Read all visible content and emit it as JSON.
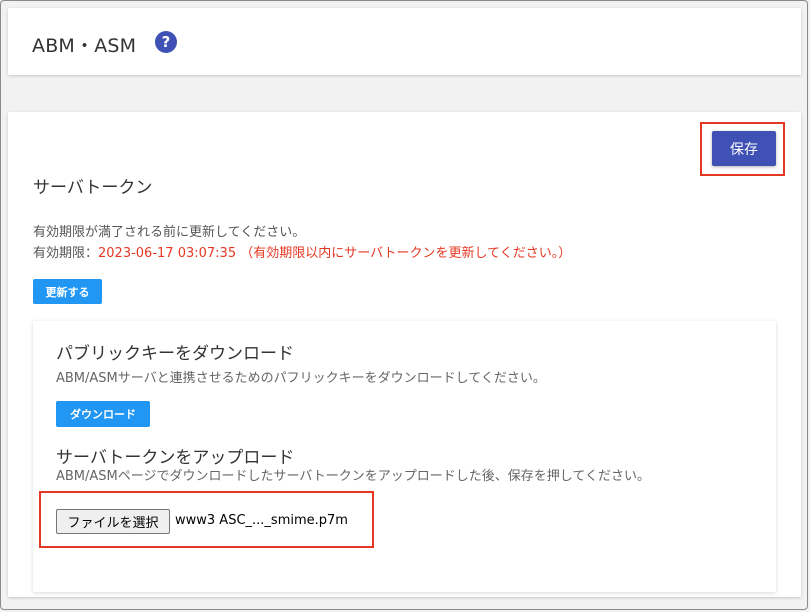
{
  "header": {
    "title": "ABM・ASM",
    "help_icon": "question-icon",
    "help_glyph": "?"
  },
  "toolbar": {
    "save_label": "保存"
  },
  "server_token": {
    "title": "サーバトークン",
    "notice": "有効期限が満了される前に更新してください。",
    "expiry_label": "有効期限：",
    "expiry_value": "2023-06-17 03:07:35 （有効期限以内にサーバトークンを更新してください。）",
    "renew_label": "更新する"
  },
  "public_key": {
    "title": "パブリックキーをダウンロード",
    "description": "ABM/ASMサーバと連携させるためのパフリックキーをダウンロードしてください。",
    "download_label": "ダウンロード"
  },
  "upload": {
    "title": "サーバトークンをアップロード",
    "description": "ABM/ASMページでダウンロードしたサーバトークンをアップロードした後、保存を押してください。",
    "choose_file_label": "ファイルを選択",
    "file_name": "www3 ASC_..._smime.p7m"
  },
  "colors": {
    "primary": "#3f51b5",
    "button_blue": "#2196f3",
    "warning_red": "#e53822",
    "highlight_red": "#e53822"
  }
}
